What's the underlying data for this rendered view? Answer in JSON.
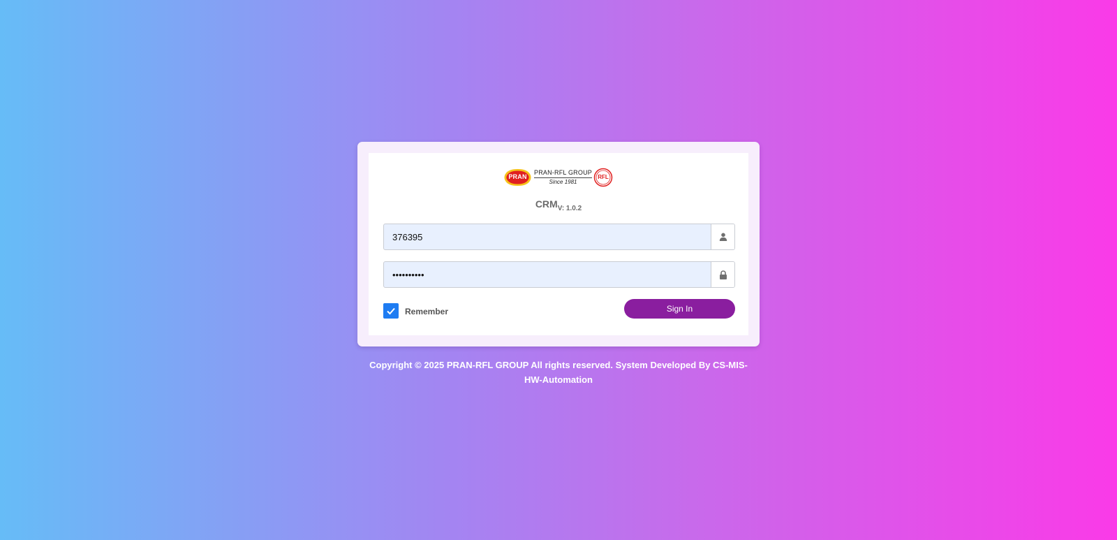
{
  "colors": {
    "card_border": "#f7eefc",
    "input_bg": "#e8f0fe",
    "checkbox": "#1e7cf2",
    "signin_button": "#8a1e9f",
    "brand_red": "#e02020",
    "brand_yellow": "#f6c21a"
  },
  "logo": {
    "left_badge_text": "PRAN",
    "group_name": "PRAN-RFL GROUP",
    "since_text": "Since 1981",
    "right_badge_text": "RFL"
  },
  "app": {
    "title": "CRM",
    "version": "V: 1.0.2"
  },
  "login": {
    "username_value": "376395",
    "username_icon": "user-icon",
    "password_value": "••••••••••",
    "password_icon": "lock-icon",
    "remember_label": "Remember",
    "remember_checked": true,
    "signin_label": "Sign In"
  },
  "footer": {
    "line1": "Copyright © 2025 PRAN-RFL GROUP All rights reserved. System Developed By CS-MIS-",
    "line2": "HW-Automation"
  }
}
